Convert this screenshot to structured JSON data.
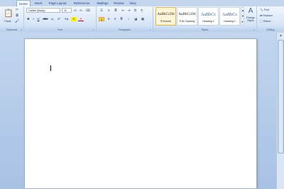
{
  "tabs": [
    "Home",
    "Insert",
    "Page Layout",
    "References",
    "Mailings",
    "Review",
    "View"
  ],
  "clipboard": {
    "paste_label": "Paste",
    "group_label": "Clipboard",
    "paste_icon": "clipboard-icon"
  },
  "font": {
    "name_value": "Calibri (Body)",
    "size_value": "11",
    "group_label": "Font",
    "buttons": [
      "B",
      "I",
      "U",
      "abe",
      "x₂",
      "x²",
      "Aa",
      "A",
      "A"
    ]
  },
  "paragraph": {
    "group_label": "Paragraph",
    "pilcrow": "¶"
  },
  "styles": {
    "group_label": "Styles",
    "tiles": [
      {
        "sample": "AaBbCcDd",
        "name": "¶ Normal"
      },
      {
        "sample": "AaBbCcDd",
        "name": "¶ No Spacing"
      },
      {
        "sample": "AaBbCc",
        "name": "Heading 1"
      },
      {
        "sample": "AaBbCc",
        "name": "Heading 2"
      }
    ],
    "change_styles_label": "Change Styles"
  },
  "editing": {
    "group_label": "Editing",
    "find": "Find",
    "replace": "Replace",
    "select": "Select"
  },
  "colors": {
    "ribbon": "#dde9f8",
    "accent": "#15428b",
    "selected_style": "#e9b44a"
  }
}
